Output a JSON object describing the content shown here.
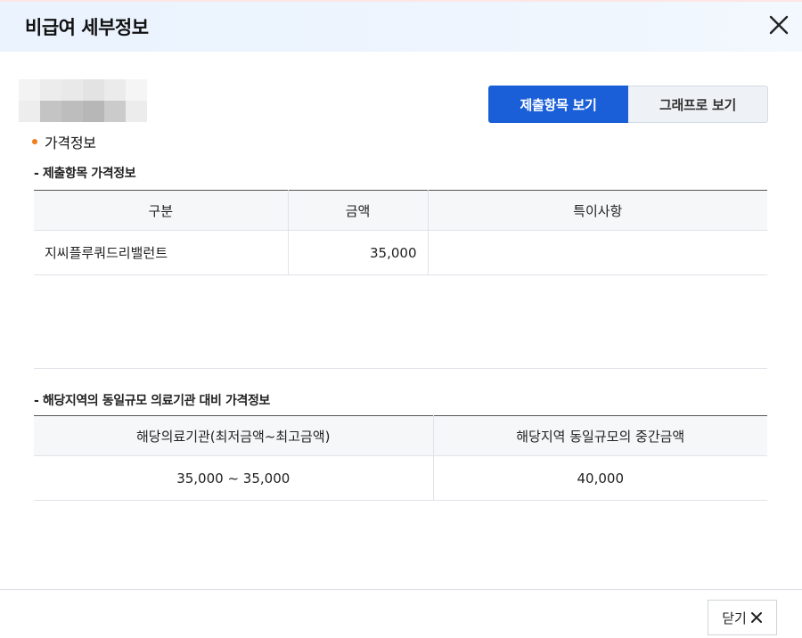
{
  "modal": {
    "title": "비급여 세부정보"
  },
  "view_toggle": {
    "active_label": "제출항목 보기",
    "inactive_label": "그래프로 보기"
  },
  "section": {
    "title": "가격정보",
    "bullet_color": "#f07d1b"
  },
  "table1": {
    "subtitle": "- 제출항목 가격정보",
    "headers": [
      "구분",
      "금액",
      "특이사항"
    ],
    "rows": [
      {
        "category": "지씨플루쿼드리밸런트",
        "amount": "35,000",
        "note": ""
      }
    ]
  },
  "table2": {
    "subtitle": "- 해당지역의 동일규모 의료기관 대비 가격정보",
    "headers": [
      "해당의료기관(최저금액~최고금액)",
      "해당지역 동일규모의 중간금액"
    ],
    "rows": [
      {
        "range": "35,000 ~ 35,000",
        "median": "40,000"
      }
    ]
  },
  "footer": {
    "close_label": "닫기"
  },
  "colors": {
    "accent": "#1b5fd8",
    "header_bg": "#eaf3fe"
  },
  "icons": {
    "header_close": "close-icon",
    "footer_close": "close-icon"
  }
}
